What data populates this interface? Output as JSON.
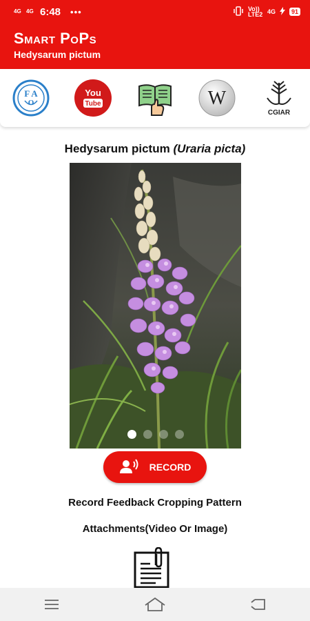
{
  "status_bar": {
    "network_left_1": "4G",
    "network_left_2": "4G",
    "time": "6:48",
    "dots": "•••",
    "volte": "Vo)) LTE2",
    "network_right": "4G",
    "battery": "91"
  },
  "app_bar": {
    "title": "Smart PoPs",
    "subtitle": "Hedysarum pictum"
  },
  "resources": [
    {
      "name": "fao-logo-icon",
      "label": "FAO"
    },
    {
      "name": "youtube-icon",
      "label": "You Tube"
    },
    {
      "name": "book-reading-icon",
      "label": ""
    },
    {
      "name": "wikipedia-icon",
      "label": "W"
    },
    {
      "name": "cgiar-logo-icon",
      "label": "CGIAR"
    }
  ],
  "plant": {
    "common_name": "Hedysarum pictum",
    "scientific_name": "(Uraria picta)"
  },
  "carousel": {
    "total": 4,
    "active_index": 0
  },
  "record_button": {
    "label": "RECORD"
  },
  "feedback_text": "Record Feedback Cropping Pattern",
  "attachments_text": "Attachments(Video Or Image)",
  "colors": {
    "primary": "#e8140f",
    "background": "#ffffff",
    "nav_bar": "#f1f1f1"
  },
  "nav_bar": {
    "icons": [
      "menu-icon",
      "home-icon",
      "back-icon"
    ]
  }
}
